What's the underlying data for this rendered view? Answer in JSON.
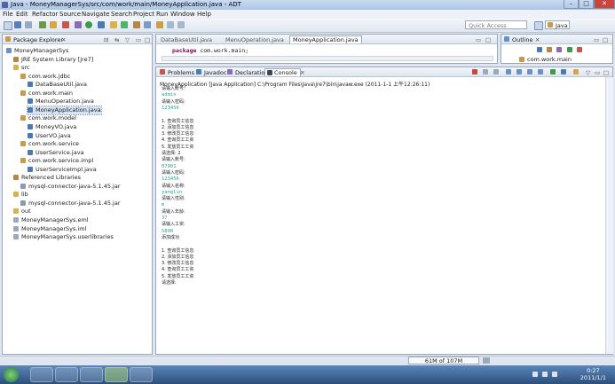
{
  "window": {
    "title": "Java - MoneyManagerSys/src/com/work/main/MoneyApplication.java - ADT",
    "btn_min": "–",
    "btn_max": "□",
    "btn_close": "✕"
  },
  "menu": [
    "File",
    "Edit",
    "Refactor",
    "Source",
    "Navigate",
    "Search",
    "Project",
    "Run",
    "Window",
    "Help"
  ],
  "toolbar": {
    "quick_access_placeholder": "Quick Access",
    "perspective_label": "Java"
  },
  "package_explorer": {
    "tab_label": "Package Explorer",
    "tree": [
      {
        "label": "MoneyManagerSys",
        "depth": 0,
        "kind": "project"
      },
      {
        "label": "JRE System Library [jre7]",
        "depth": 1,
        "kind": "library"
      },
      {
        "label": "src",
        "depth": 1,
        "kind": "folder"
      },
      {
        "label": "com.work.jdbc",
        "depth": 2,
        "kind": "package"
      },
      {
        "label": "DataBaseUtil.java",
        "depth": 3,
        "kind": "java"
      },
      {
        "label": "com.work.main",
        "depth": 2,
        "kind": "package"
      },
      {
        "label": "MenuOperation.java",
        "depth": 3,
        "kind": "java"
      },
      {
        "label": "MoneyApplication.java",
        "depth": 3,
        "kind": "java",
        "selected": true
      },
      {
        "label": "com.work.model",
        "depth": 2,
        "kind": "package"
      },
      {
        "label": "MoneyVO.java",
        "depth": 3,
        "kind": "java"
      },
      {
        "label": "UserVO.java",
        "depth": 3,
        "kind": "java"
      },
      {
        "label": "com.work.service",
        "depth": 2,
        "kind": "package"
      },
      {
        "label": "UserService.java",
        "depth": 3,
        "kind": "java"
      },
      {
        "label": "com.work.service.impl",
        "depth": 2,
        "kind": "package"
      },
      {
        "label": "UserServiceImpl.java",
        "depth": 3,
        "kind": "java"
      },
      {
        "label": "Referenced Libraries",
        "depth": 1,
        "kind": "library"
      },
      {
        "label": "mysql-connector-java-5.1.45.jar",
        "depth": 2,
        "kind": "jar"
      },
      {
        "label": "lib",
        "depth": 1,
        "kind": "folder"
      },
      {
        "label": "mysql-connector-java-5.1.45.jar",
        "depth": 2,
        "kind": "jar"
      },
      {
        "label": "out",
        "depth": 1,
        "kind": "folder"
      },
      {
        "label": "MoneyManagerSys.eml",
        "depth": 1,
        "kind": "file"
      },
      {
        "label": "MoneyManagerSys.iml",
        "depth": 1,
        "kind": "file"
      },
      {
        "label": "MoneyManagerSys.userlibraries",
        "depth": 1,
        "kind": "file"
      }
    ]
  },
  "editor": {
    "tabs": [
      "DataBaseUtil.java",
      "MenuOperation.java",
      "MoneyApplication.java"
    ],
    "active_tab": 2,
    "code_keyword": "package",
    "code_rest": " com.work.main;"
  },
  "outline": {
    "tab_label": "Outline",
    "item": "com.work.main"
  },
  "console_view": {
    "tabs": [
      "Problems",
      "Javadoc",
      "Declaration",
      "Console"
    ],
    "active_tab": 3,
    "header": "MoneyApplication [Java Application] C:\\Program Files\\Java\\jre7\\bin\\javaw.exe (2011-1-1 上午12:26:11)",
    "lines": [
      {
        "text": "请输入账号:",
        "input": false
      },
      {
        "text": "admin",
        "input": true
      },
      {
        "text": "请输入密码:",
        "input": false
      },
      {
        "text": "123456",
        "input": true
      },
      {
        "text": "",
        "input": false
      },
      {
        "text": "1. 查询员工信息",
        "input": false
      },
      {
        "text": "2. 添加员工信息",
        "input": false
      },
      {
        "text": "3. 修改员工信息",
        "input": false
      },
      {
        "text": "4. 查询员工工资",
        "input": false
      },
      {
        "text": "5. 发放员工工资",
        "input": false
      },
      {
        "text": "请选择: 2",
        "input": false
      },
      {
        "text": "请输入账号:",
        "input": false
      },
      {
        "text": "07001",
        "input": true
      },
      {
        "text": "请输入密码:",
        "input": false
      },
      {
        "text": "123456",
        "input": true
      },
      {
        "text": "请输入名称:",
        "input": false
      },
      {
        "text": "yanglin",
        "input": true
      },
      {
        "text": "请输入性别:",
        "input": false
      },
      {
        "text": "m",
        "input": true
      },
      {
        "text": "请输入年龄:",
        "input": false
      },
      {
        "text": "37",
        "input": true
      },
      {
        "text": "请输入工资:",
        "input": false
      },
      {
        "text": "5800",
        "input": true
      },
      {
        "text": "添加成功",
        "input": false
      },
      {
        "text": "",
        "input": false
      },
      {
        "text": "1. 查询员工信息",
        "input": false
      },
      {
        "text": "2. 添加员工信息",
        "input": false
      },
      {
        "text": "3. 修改员工信息",
        "input": false
      },
      {
        "text": "4. 查询员工工资",
        "input": false
      },
      {
        "text": "5. 发放员工工资",
        "input": false
      },
      {
        "text": "请选择:",
        "input": false
      }
    ]
  },
  "status": {
    "memory": "61M of 107M"
  },
  "taskbar": {
    "time": "0:27",
    "date": "2011/1/1"
  },
  "colors": {
    "accent": "#3875d7",
    "console_input": "#2aa198",
    "keyword": "#7f0055"
  }
}
